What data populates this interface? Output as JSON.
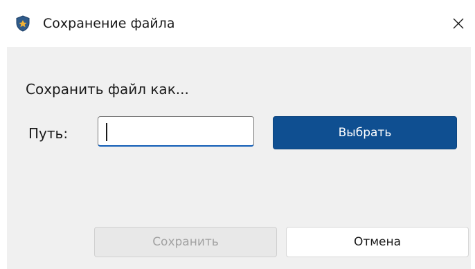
{
  "window": {
    "title": "Сохранение файла",
    "app_icon": "shield-icon",
    "close_icon": "close-icon"
  },
  "dialog": {
    "heading": "Сохранить файл как...",
    "path_label": "Путь:",
    "path_value": "",
    "browse_label": "Выбрать",
    "save_label": "Сохранить",
    "save_disabled": true,
    "cancel_label": "Отмена"
  },
  "colors": {
    "accent": "#0f4f91",
    "content_bg": "#f0f0f0",
    "shield_fill": "#2f5b8a",
    "shield_emblem": "#f2b233"
  }
}
